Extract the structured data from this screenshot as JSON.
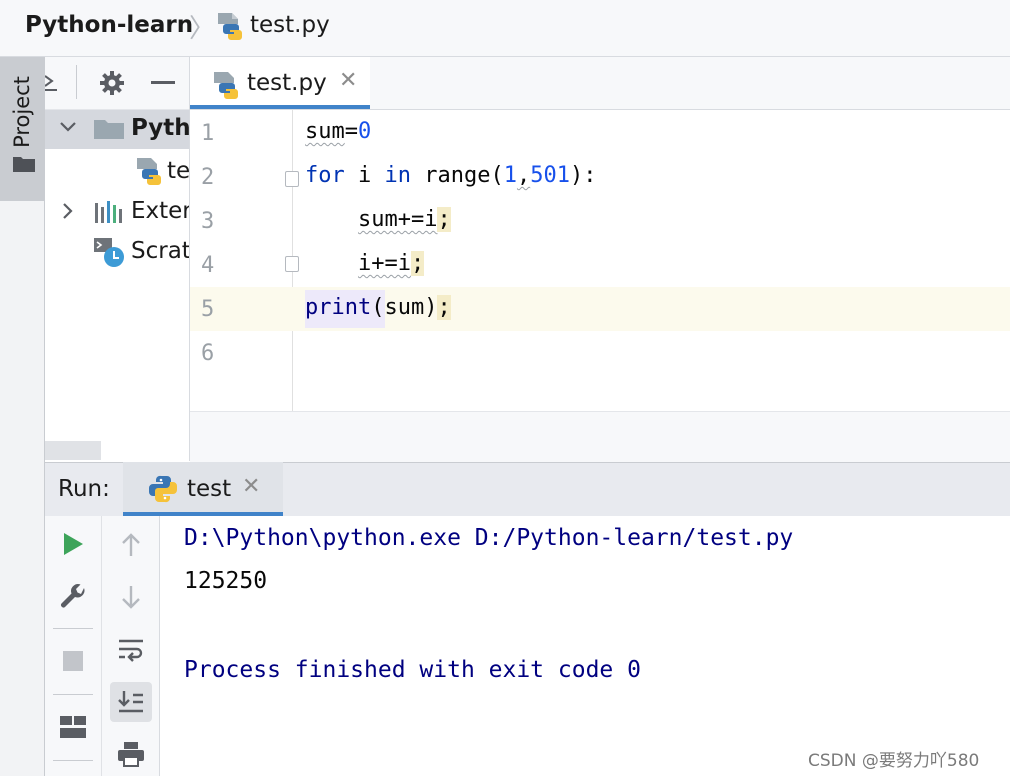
{
  "breadcrumb": {
    "project": "Python-learn",
    "separator": "〉",
    "file": "test.py"
  },
  "tool_window": {
    "project_label": "Project"
  },
  "project_panel": {
    "tree": [
      {
        "label": "Python-learn",
        "icon": "folder-icon",
        "expanded": true
      },
      {
        "label": "test.py",
        "icon": "python-file-icon"
      },
      {
        "label": "External Libraries",
        "icon": "library-icon",
        "expanded": false
      },
      {
        "label": "Scratches and Consoles",
        "icon": "scratch-icon"
      }
    ]
  },
  "editor": {
    "tab_label": "test.py",
    "line_numbers": [
      "1",
      "2",
      "3",
      "4",
      "5",
      "6"
    ],
    "code_tokens": {
      "l1_name": "sum",
      "l1_op": "=",
      "l1_num": "0",
      "l2_for": "for",
      "l2_var": " i ",
      "l2_in": "in",
      "l2_range": " range(",
      "l2_n1": "1",
      "l2_comma": ",",
      "l2_n2": "501",
      "l2_end": "):",
      "l3_indent": "    ",
      "l3_code": "sum+=i",
      "l3_semi": ";",
      "l4_indent": "    ",
      "l4_code": "i+=i",
      "l4_semi": ";",
      "l5_print": "print",
      "l5_rest": "(sum)",
      "l5_semi": ";"
    }
  },
  "run_panel": {
    "title": "Run:",
    "tab_label": "test",
    "console": {
      "command": "D:\\Python\\python.exe D:/Python-learn/test.py",
      "output": "125250",
      "finished": "Process finished with exit code 0"
    }
  },
  "watermark": "CSDN @要努力吖580",
  "colors": {
    "accent": "#4083c9",
    "keyword": "#0033b3",
    "number": "#1750eb",
    "console_system": "#000080"
  }
}
